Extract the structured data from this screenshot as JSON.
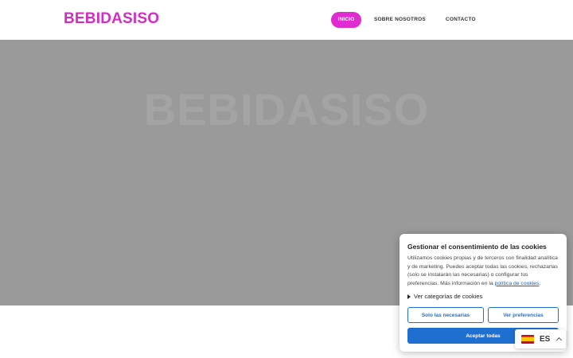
{
  "header": {
    "logo": "BEBIDASISO",
    "nav": [
      {
        "label": "INICIO",
        "active": true
      },
      {
        "label": "SOBRE NOSOTROS",
        "active": false
      },
      {
        "label": "CONTACTO",
        "active": false
      }
    ]
  },
  "hero": {
    "title": "BEBIDASISO"
  },
  "cookie": {
    "title": "Gestionar el consentimiento de las cookies",
    "text": "Utilizamos cookies propias y de terceros con finalidad analítica y de marketing. Puedes aceptar todas las cookies, rechazarlas (solo se instalarán las necesarias) o configurar tus preferencias. Más información en la ",
    "link_text": "política de cookies",
    "text_end": ".",
    "categories_label": "Ver categorías de cookies",
    "btn_necessary": "Solo las necesarias",
    "btn_preferences": "Ver preferencias",
    "btn_accept": "Aceptar todas"
  },
  "lang": {
    "code": "ES"
  },
  "colors": {
    "brand": "#d42bc6",
    "button_blue": "#1f6fd0",
    "hero_bg": "#9a9a9a"
  }
}
